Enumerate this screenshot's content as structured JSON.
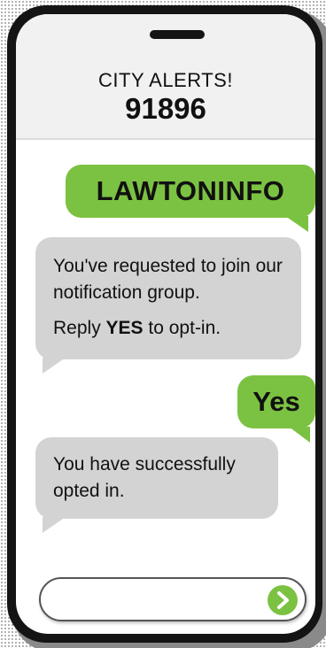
{
  "header": {
    "title": "CITY ALERTS!",
    "number": "91896"
  },
  "messages": [
    {
      "type": "sent",
      "text": "LAWTONINFO"
    },
    {
      "type": "received",
      "line1": "You've requested to join our notification group.",
      "line2_prefix": "Reply ",
      "line2_bold": "YES",
      "line2_suffix": " to opt-in."
    },
    {
      "type": "sent",
      "text": "Yes"
    },
    {
      "type": "received",
      "line1": "You have successfully opted in."
    }
  ],
  "composer": {
    "value": "",
    "send_icon": "chevron-right-icon"
  },
  "colors": {
    "sent_bubble": "#7cc242",
    "received_bubble": "#d4d3d3",
    "phone_frame": "#141414"
  }
}
